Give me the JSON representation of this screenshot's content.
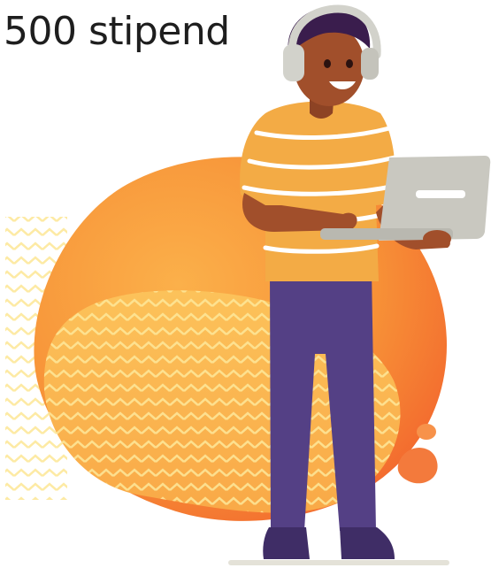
{
  "caption": {
    "text": "500 stipend"
  },
  "colors": {
    "blob_main": "#f7a03d",
    "blob_edge": "#f26a2e",
    "blob_light": "#fbc45c",
    "chevron": "#fde89a",
    "shirt": "#f3ab45",
    "shirt_stripe": "#ffffff",
    "skin": "#a14f2b",
    "hair": "#3a1d4d",
    "headphones": "#d2d2cb",
    "pants": "#544085",
    "shoes": "#3f2d66",
    "laptop": "#c9c8c0",
    "ground": "#e4e2d8"
  },
  "illustration": {
    "subject": "person-with-headphones-holding-laptop",
    "icons": [
      "headphones-icon",
      "laptop-icon"
    ]
  }
}
